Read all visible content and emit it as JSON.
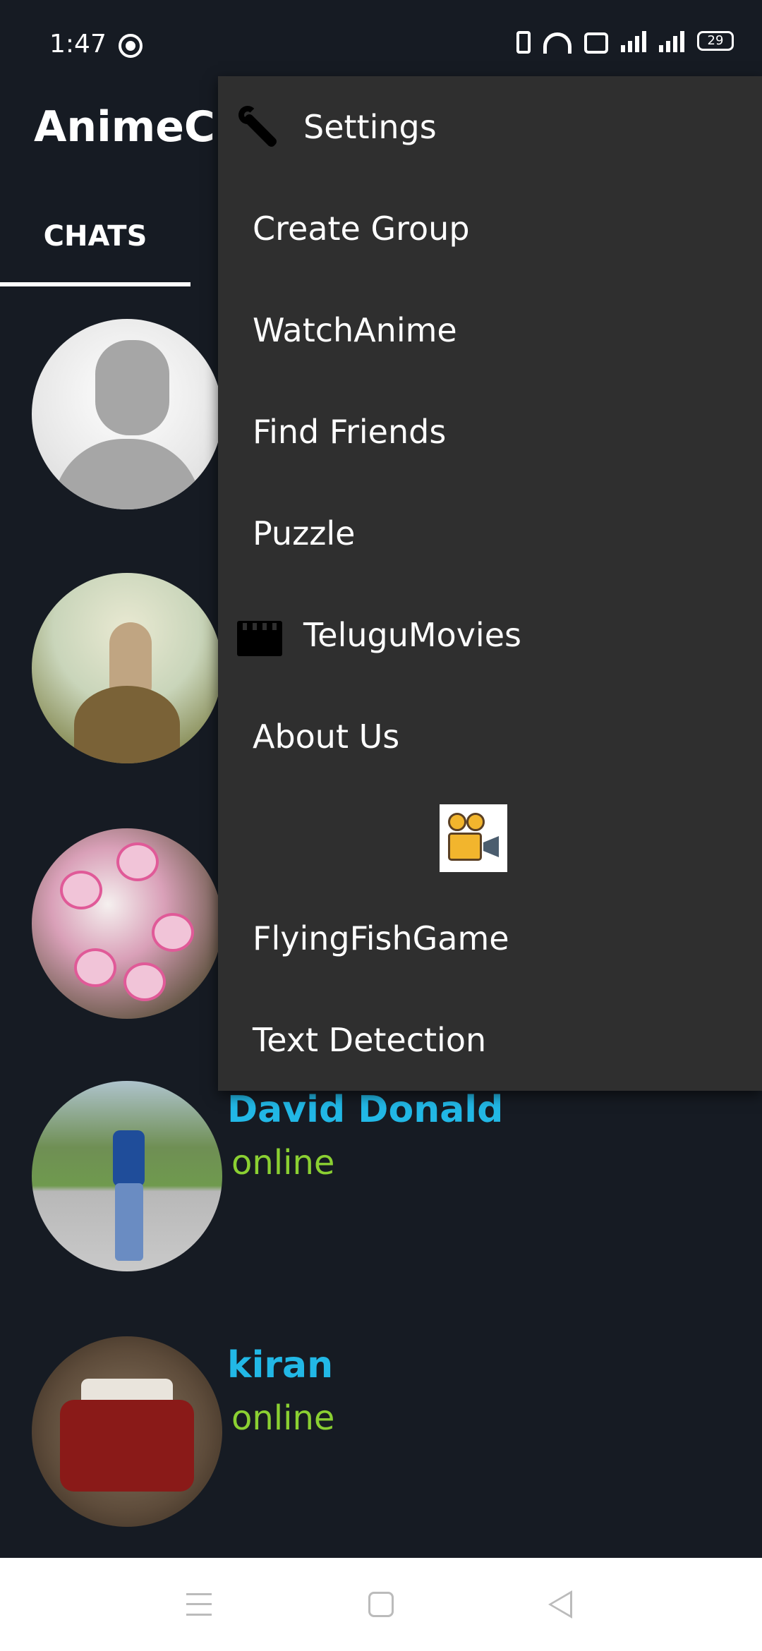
{
  "status_bar": {
    "time": "1:47",
    "battery": "29",
    "icons": [
      "whatsapp-icon",
      "vibrate-icon",
      "wifi-icon",
      "wifi-calling-icon",
      "signal-icon",
      "signal-icon",
      "battery-icon"
    ]
  },
  "app": {
    "title": "AnimeChat",
    "tabs": [
      {
        "label": "CHATS",
        "selected": true
      }
    ]
  },
  "chats": [
    {
      "name": "",
      "status": "",
      "avatar": "default-person-avatar"
    },
    {
      "name": "",
      "status": "",
      "avatar": "surreal-hand-art-avatar"
    },
    {
      "name": "",
      "status": "",
      "avatar": "pink-flowers-avatar"
    },
    {
      "name": "David Donald",
      "status": "online",
      "avatar": "man-walking-avatar"
    },
    {
      "name": "kiran",
      "status": "online",
      "avatar": "red-jeep-avatar"
    }
  ],
  "menu": {
    "items": [
      {
        "label": "Settings",
        "icon": "wrench-icon"
      },
      {
        "label": "Create Group"
      },
      {
        "label": "WatchAnime"
      },
      {
        "label": "Find Friends"
      },
      {
        "label": "Puzzle"
      },
      {
        "label": "TeluguMovies",
        "icon": "clapperboard-icon"
      },
      {
        "label": "About Us"
      },
      {
        "label": "",
        "icon": "movie-projector-icon"
      },
      {
        "label": "FlyingFishGame"
      },
      {
        "label": "Text Detection"
      }
    ]
  },
  "colors": {
    "background": "#161b23",
    "menu_background": "#2f2f2f",
    "name_color": "#22b8e6",
    "online_color": "#8bd032"
  }
}
